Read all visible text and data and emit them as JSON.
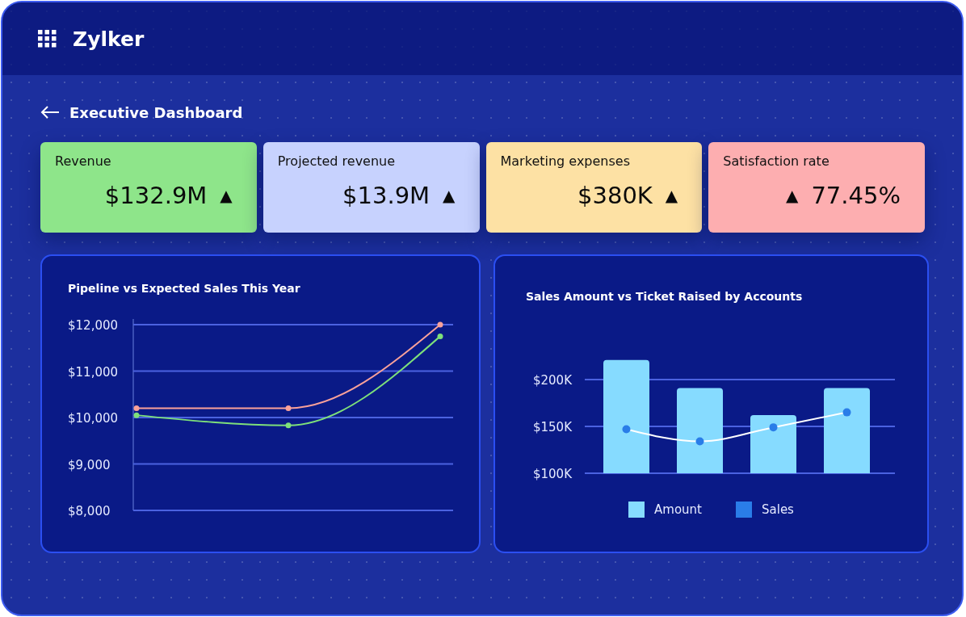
{
  "header": {
    "brand": "Zylker"
  },
  "page": {
    "title": "Executive Dashboard"
  },
  "kpis": [
    {
      "label": "Revenue",
      "value": "$132.9M",
      "indicator_after": "▲",
      "color": "#8ee58a"
    },
    {
      "label": "Projected revenue",
      "value": "$13.9M",
      "indicator_after": "▲",
      "color": "#c7d2fe"
    },
    {
      "label": "Marketing expenses",
      "value": "$380K",
      "indicator_after": "▲",
      "color": "#fde1a4"
    },
    {
      "label": "Satisfaction rate",
      "value": "77.45%",
      "indicator_before": "▲",
      "color": "#fdaeb0"
    }
  ],
  "charts": [
    {
      "chart_data": {
        "type": "line",
        "title": "Pipeline vs Expected Sales This Year",
        "grid": true,
        "ylim": [
          8000,
          12000
        ],
        "yticks": [
          {
            "value": 12000,
            "label": "$12,000"
          },
          {
            "value": 11000,
            "label": "$11,000"
          },
          {
            "value": 10000,
            "label": "$10,000"
          },
          {
            "value": 9000,
            "label": "$9,000"
          },
          {
            "value": 8000,
            "label": "$8,000"
          }
        ],
        "series": [
          {
            "color": "#f9a19a",
            "marker": "o",
            "values": [
              10200,
              10200,
              12000
            ]
          },
          {
            "color": "#7ee07a",
            "marker": "o",
            "values": [
              10050,
              9830,
              11750
            ]
          }
        ]
      }
    },
    {
      "chart_data": {
        "type": "bar",
        "title": "Sales Amount vs Ticket Raised by Accounts",
        "grid": true,
        "ylim": [
          100000,
          221000
        ],
        "yticks": [
          {
            "value": 200000,
            "label": "$200K"
          },
          {
            "value": 150000,
            "label": "$150K"
          },
          {
            "value": 100000,
            "label": "$100K"
          }
        ],
        "series": [
          {
            "name": "Amount",
            "type": "bar",
            "color": "#86dbff",
            "values": [
              221000,
              191000,
              162000,
              191000
            ]
          },
          {
            "name": "Sales",
            "type": "line",
            "marker": "o",
            "color": "#2a7de8",
            "values": [
              147000,
              134000,
              149000,
              165000
            ]
          }
        ]
      }
    }
  ]
}
